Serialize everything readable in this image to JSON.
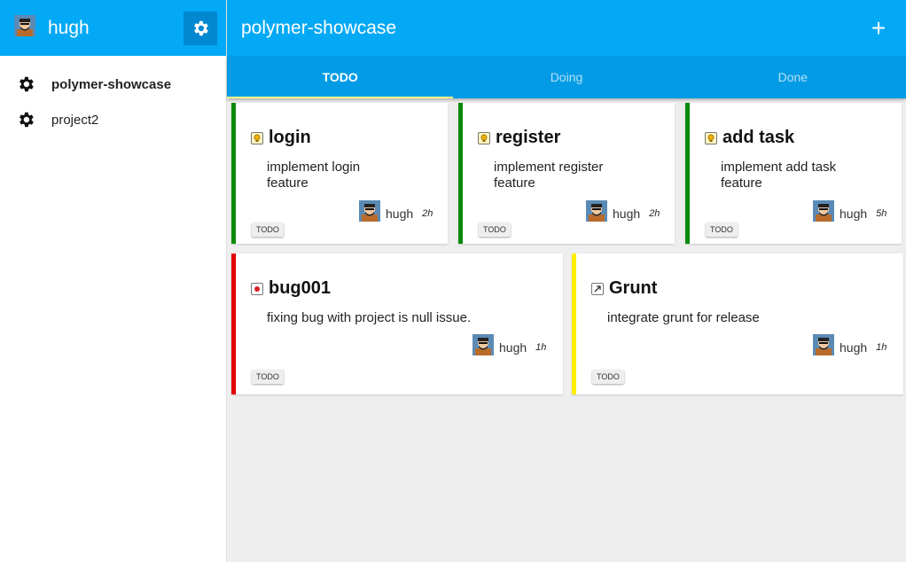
{
  "sidebar": {
    "user_name": "hugh",
    "items": [
      {
        "label": "polymer-showcase",
        "active": true
      },
      {
        "label": "project2",
        "active": false
      }
    ]
  },
  "toolbar": {
    "title": "polymer-showcase",
    "add_label": "+"
  },
  "tabs": [
    {
      "label": "TODO",
      "selected": true
    },
    {
      "label": "Doing",
      "selected": false
    },
    {
      "label": "Done",
      "selected": false
    }
  ],
  "cards": [
    {
      "title": "login",
      "type": "idea-icon",
      "stripe_color": "#0a8a0a",
      "description": [
        "implement login",
        "feature"
      ],
      "user": "hugh",
      "age": "2h",
      "status": "TODO"
    },
    {
      "title": "register",
      "type": "idea-icon",
      "stripe_color": "#0a8a0a",
      "description": [
        "implement register",
        "feature"
      ],
      "user": "hugh",
      "age": "2h",
      "status": "TODO"
    },
    {
      "title": "add task",
      "type": "idea-icon",
      "stripe_color": "#0a8a0a",
      "description": [
        "implement add task",
        "feature"
      ],
      "user": "hugh",
      "age": "5h",
      "status": "TODO"
    },
    {
      "title": "bug001",
      "type": "bug-icon",
      "stripe_color": "#e00000",
      "description": [
        "fixing bug with project is null issue."
      ],
      "user": "hugh",
      "age": "1h",
      "status": "TODO"
    },
    {
      "title": "Grunt",
      "type": "improvement-icon",
      "stripe_color": "#ffee00",
      "description": [
        "integrate grunt for release"
      ],
      "user": "hugh",
      "age": "1h",
      "status": "TODO"
    }
  ],
  "colors": {
    "primary": "#03a9f4",
    "primary_dark": "#039be5",
    "accent": "#ffff8d"
  }
}
